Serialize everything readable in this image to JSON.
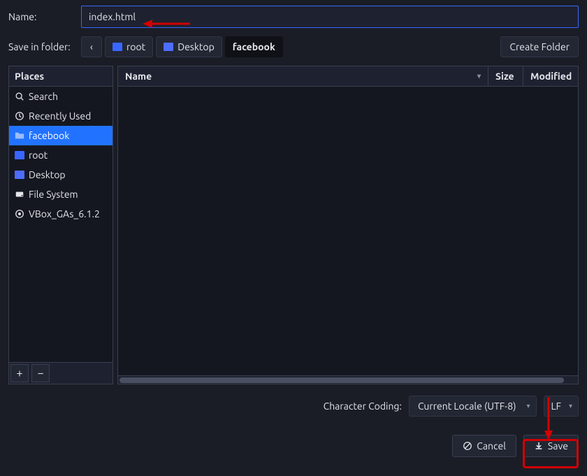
{
  "labels": {
    "name": "Name:",
    "save_in_folder": "Save in folder:",
    "character_coding": "Character Coding:"
  },
  "name_input": {
    "value": "index.html"
  },
  "breadcrumb": {
    "back_symbol": "‹",
    "items": [
      {
        "label": "root",
        "icon": "home"
      },
      {
        "label": "Desktop",
        "icon": "desktop"
      },
      {
        "label": "facebook",
        "icon": null,
        "active": true
      }
    ]
  },
  "buttons": {
    "create_folder": "Create Folder",
    "cancel": "Cancel",
    "save": "Save"
  },
  "places": {
    "header": "Places",
    "items": [
      {
        "label": "Search",
        "icon": "search"
      },
      {
        "label": "Recently Used",
        "icon": "clock"
      },
      {
        "label": "facebook",
        "icon": "folder",
        "selected": true
      },
      {
        "label": "root",
        "icon": "home"
      },
      {
        "label": "Desktop",
        "icon": "desktop"
      },
      {
        "label": "File System",
        "icon": "disk"
      },
      {
        "label": "VBox_GAs_6.1.2",
        "icon": "cd"
      }
    ],
    "add_symbol": "+",
    "remove_symbol": "−"
  },
  "files": {
    "columns": {
      "name": "Name",
      "size": "Size",
      "modified": "Modified"
    }
  },
  "coding": {
    "selected": "Current Locale (UTF-8)",
    "line_ending": "LF"
  }
}
